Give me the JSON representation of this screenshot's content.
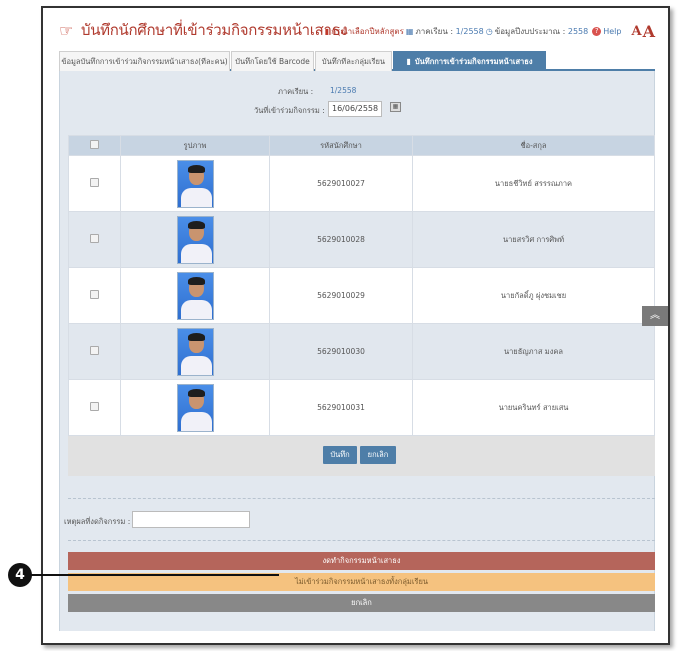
{
  "header": {
    "title": "บันทึกนักศึกษาที่เข้าร่วมกิจกรรมหน้าเสาธง",
    "course_prompt": "กรุณาเลือกปีหลักสูตร",
    "semester_label": "ภาคเรียน :",
    "semester_value": "1/2558",
    "budget_label": "ข้อมูลปีงบประมาณ :",
    "budget_value": "2558",
    "help_label": "Help",
    "font_small": "A",
    "font_large": "A"
  },
  "tabs": [
    {
      "label": "ข้อมูลบันทึกการเข้าร่วมกิจกรรมหน้าเสาธง(ทีละคน)",
      "active": false
    },
    {
      "label": "บันทึกโดยใช้ Barcode",
      "active": false
    },
    {
      "label": "บันทึกทีละกลุ่มเรียน",
      "active": false
    },
    {
      "label": "บันทึกการเข้าร่วมกิจกรรมหน้าเสาธง",
      "active": true
    }
  ],
  "form": {
    "semester_label": "ภาคเรียน :",
    "semester_value": "1/2558",
    "date_label": "วันที่เข้าร่วมกิจกรรม :",
    "date_value": "16/06/2558"
  },
  "table": {
    "headers": [
      "",
      "รูปภาพ",
      "รหัสนักศึกษา",
      "ชื่อ-สกุล"
    ],
    "rows": [
      {
        "id": "5629010027",
        "name": "นายธชีวิทย์ สรรรณภาค"
      },
      {
        "id": "5629010028",
        "name": "นายสรวิศ การศิพท์"
      },
      {
        "id": "5629010029",
        "name": "นายกัลดิ์ภู ผุ่งชมเชย"
      },
      {
        "id": "5629010030",
        "name": "นายธัญภาส มงคล"
      },
      {
        "id": "5629010031",
        "name": "นายนครินทร์ สายเสน"
      }
    ]
  },
  "actions": {
    "save_label": "บันทึก",
    "cancel_label": "ยกเลิก"
  },
  "reason": {
    "label": "เหตุผลที่งดกิจกรรม :",
    "value": ""
  },
  "bars": {
    "cancel_activity": "งดทำกิจกรรมหน้าเสาธง",
    "not_join": "ไม่เข้าร่วมกิจกรรมหน้าเสาธงทั้งกลุ่มเรียน",
    "cancel": "ยกเลิก"
  },
  "callout": {
    "number": "4"
  },
  "colors": {
    "accent": "#4e7ea8",
    "title": "#b03a2e",
    "cancel_activity_bar": "#b5655b",
    "not_join_bar": "#f5c27f",
    "cancel_bar": "#888888"
  }
}
